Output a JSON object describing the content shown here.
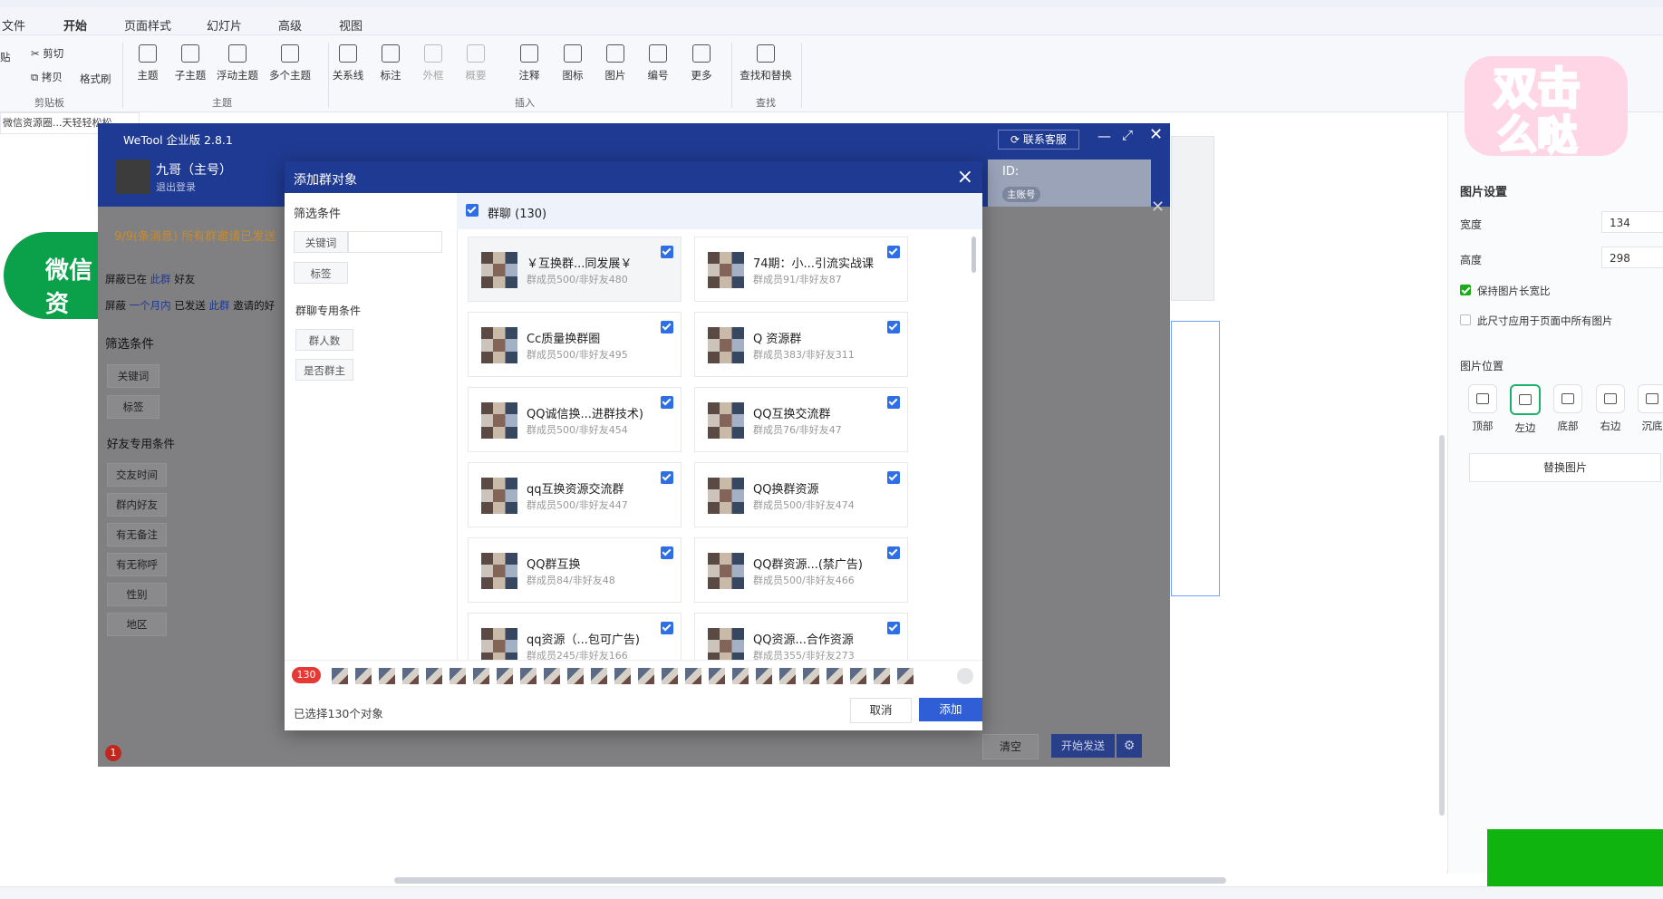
{
  "wps": {
    "menu_tabs": [
      "文件",
      "开始",
      "页面样式",
      "幻灯片",
      "高级",
      "视图"
    ],
    "active_tab": "开始",
    "clipboard": {
      "cut": "剪切",
      "copy": "拷贝",
      "format_painter": "格式刷",
      "paste": "贴",
      "group": "剪贴板"
    },
    "topic_group": {
      "items": [
        "主题",
        "子主题",
        "浮动主题",
        "多个主题"
      ],
      "label": "主题"
    },
    "insert_group": {
      "items": [
        "关系线",
        "标注",
        "外框",
        "概要",
        "注释",
        "图标",
        "图片",
        "编号",
        "更多"
      ],
      "label": "插入"
    },
    "find_group": {
      "item": "查找和替换",
      "label": "查找"
    },
    "doc_tab": "微信资源圈...天轻轻松松"
  },
  "right_panel": {
    "title": "图片设置",
    "width_label": "宽度",
    "width_value": "134",
    "height_label": "高度",
    "height_value": "298",
    "keep_ratio_label": "保持图片长宽比",
    "keep_ratio_checked": true,
    "apply_all_label": "此尺寸应用于页面中所有图片",
    "apply_all_checked": false,
    "position_title": "图片位置",
    "positions": [
      "顶部",
      "左边",
      "底部",
      "右边",
      "沉底"
    ],
    "selected_position": "左边",
    "replace_button": "替换图片"
  },
  "wetool": {
    "title": "WeTool 企业版 2.8.1",
    "user_name": "九哥（主号）",
    "logout": "退出登录",
    "contact_support": "联系客服",
    "id_label": "ID:",
    "main_badge": "主账号",
    "notice": "9/9(条消息)  所有群邀请已发送",
    "shield_line1": {
      "prefix": "屏蔽已在",
      "link": "此群",
      "suffix": "好友"
    },
    "shield_line2": {
      "prefix": "屏蔽",
      "link1": "一个月内",
      "mid": "已发送",
      "link2": "此群",
      "suffix": "邀请的好"
    },
    "filter_title": "筛选条件",
    "keyword": "关键词",
    "tag": "标签",
    "friend_filter_title": "好友专用条件",
    "friend_filters": [
      "交友时间",
      "群内好友",
      "有无备注",
      "有无称呼",
      "性别",
      "地区"
    ],
    "clear_button": "清空",
    "start_send_button": "开始发送",
    "green_pill_text": "微信资"
  },
  "dialog": {
    "title": "添加群对象",
    "filter_title": "筛选条件",
    "keyword_label": "关键词",
    "tag_label": "标签",
    "group_filter_title": "群聊专用条件",
    "group_filters": [
      "群人数",
      "是否群主"
    ],
    "group_header": "群聊 (130)",
    "groups": [
      {
        "name": "￥互换群...同发展￥",
        "sub": "群成员500/非好友480"
      },
      {
        "name": "74期：小...引流实战课",
        "sub": "群成员91/非好友87"
      },
      {
        "name": "Cc质量换群圈",
        "sub": "群成员500/非好友495"
      },
      {
        "name": "Q 资源群",
        "sub": "群成员383/非好友311"
      },
      {
        "name": "QQ诚信换...进群技术)",
        "sub": "群成员500/非好友454"
      },
      {
        "name": "QQ互换交流群",
        "sub": "群成员76/非好友47"
      },
      {
        "name": "qq互换资源交流群",
        "sub": "群成员500/非好友447"
      },
      {
        "name": "QQ换群资源",
        "sub": "群成员500/非好友474"
      },
      {
        "name": "QQ群互换",
        "sub": "群成员84/非好友48"
      },
      {
        "name": "QQ群资源...(禁广告)",
        "sub": "群成员500/非好友466"
      },
      {
        "name": "qq资源（...包可广告)",
        "sub": "群成员245/非好友166"
      },
      {
        "name": "QQ资源...合作资源",
        "sub": "群成员355/非好友273"
      }
    ],
    "selected_badge": "130",
    "selected_count_text": "已选择130个对象",
    "cancel_button": "取消",
    "add_button": "添加"
  },
  "colors": {
    "wetool_blue": "#1f3a92",
    "accent_blue": "#2f5ed6",
    "check_blue": "#2f6fe6",
    "green": "#0aa14a",
    "badge_red": "#e53935"
  }
}
